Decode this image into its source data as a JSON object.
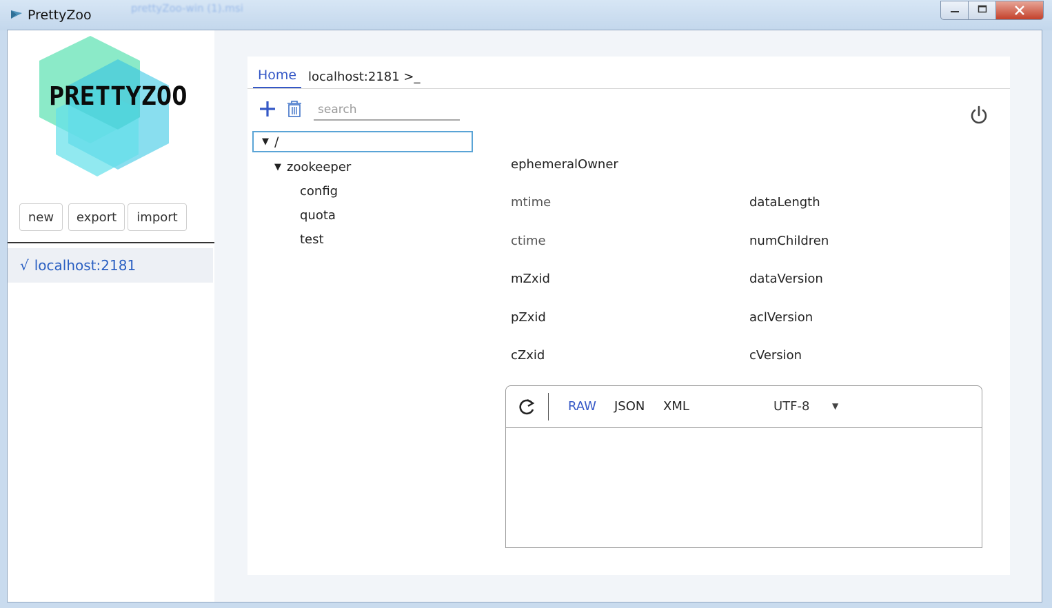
{
  "window": {
    "title": "PrettyZoo",
    "background_window_title": "prettyZoo-win (1).msi",
    "controls": {
      "minimize": "minimize-icon",
      "maximize": "maximize-icon",
      "close": "close-icon"
    }
  },
  "sidebar": {
    "logo_text": "PRETTYZOO",
    "buttons": {
      "new": "new",
      "export": "export",
      "import": "import"
    },
    "servers": [
      {
        "check": "√",
        "label": "localhost:2181",
        "selected": true
      }
    ]
  },
  "tabs": [
    {
      "label": "Home",
      "active": true
    },
    {
      "label": "localhost:2181 >_",
      "active": false
    }
  ],
  "toolbar": {
    "add_icon": "plus-icon",
    "delete_icon": "trash-icon",
    "search_placeholder": "search",
    "search_value": "",
    "power_icon": "power-icon"
  },
  "tree": {
    "root": {
      "label": "/",
      "expanded": true,
      "selected": true
    },
    "zookeeper": {
      "label": "zookeeper",
      "expanded": true
    },
    "children": [
      "config",
      "quota",
      "test"
    ]
  },
  "stat_fields": {
    "ephemeralOwner": "ephemeralOwner",
    "mtime": "mtime",
    "ctime": "ctime",
    "mZxid": "mZxid",
    "pZxid": "pZxid",
    "cZxid": "cZxid",
    "dataLength": "dataLength",
    "numChildren": "numChildren",
    "dataVersion": "dataVersion",
    "aclVersion": "aclVersion",
    "cVersion": "cVersion"
  },
  "editor": {
    "refresh_icon": "refresh-icon",
    "formats": {
      "raw": "RAW",
      "json": "JSON",
      "xml": "XML"
    },
    "active_format": "RAW",
    "charset": "UTF-8",
    "content": ""
  },
  "colors": {
    "accent": "#3457c6",
    "selection_border": "#5aa4d6",
    "sidebar_selected_bg": "#edf0f5"
  }
}
